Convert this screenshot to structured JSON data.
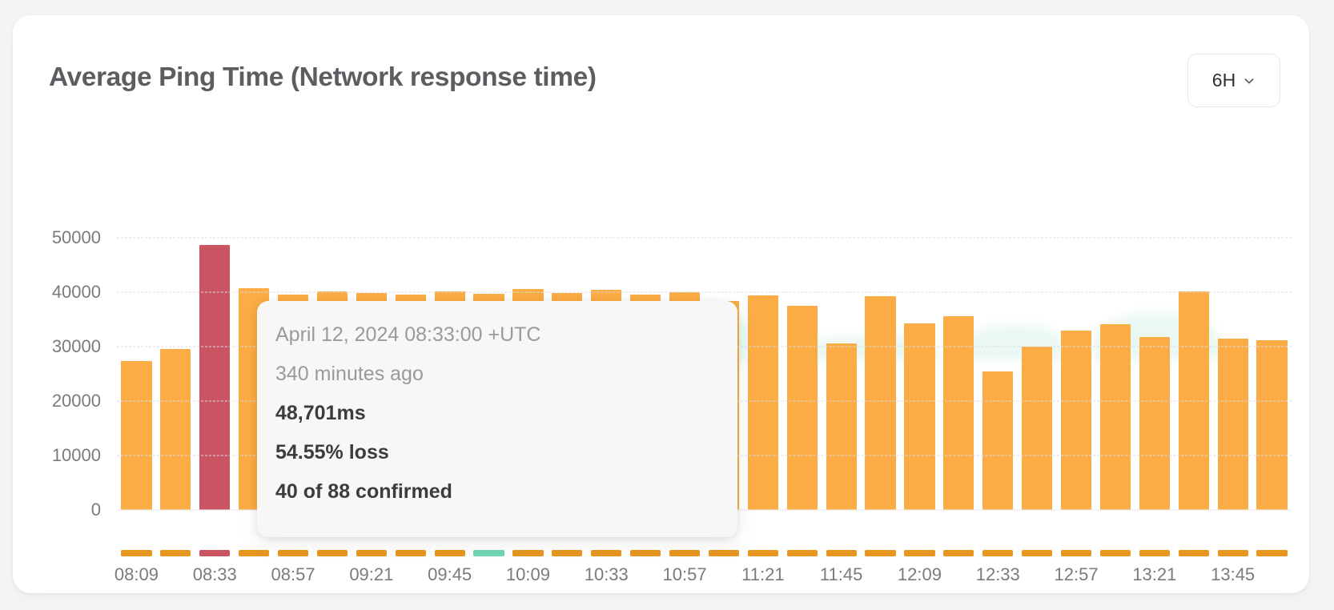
{
  "header": {
    "title": "Average Ping Time (Network response time)",
    "range_selector": {
      "label": "6H",
      "icon": "chevron-down-icon"
    }
  },
  "tooltip": {
    "timestamp": "April 12, 2024 08:33:00 +UTC",
    "relative": "340 minutes ago",
    "latency": "48,701ms",
    "loss": "54.55% loss",
    "confirmed": "40 of 88 confirmed"
  },
  "colors": {
    "bar": "#fbac44",
    "bar_highlight": "#cb5462",
    "status_ok": "#6fd6b5",
    "status_bad": "#cb5462",
    "grid": "#dddde2",
    "text_muted": "#7a7b80",
    "title": "#5d5d61",
    "card": "#ffffff",
    "page": "#f5f5f6"
  },
  "chart_data": {
    "type": "bar",
    "title": "Average Ping Time (Network response time)",
    "xlabel": "",
    "ylabel": "",
    "ylim": [
      0,
      55000
    ],
    "yticks": [
      0,
      10000,
      20000,
      30000,
      40000,
      50000
    ],
    "ytick_labels": [
      "0",
      "10000",
      "20000",
      "30000",
      "40000",
      "50000"
    ],
    "grid": true,
    "legend": false,
    "xtick_labels": [
      "08:09",
      "08:33",
      "08:57",
      "09:21",
      "09:45",
      "10:09",
      "10:33",
      "10:57",
      "11:21",
      "11:45",
      "12:09",
      "12:33",
      "12:57",
      "13:21",
      "13:45"
    ],
    "xtick_indices": [
      0,
      2,
      4,
      6,
      8,
      10,
      12,
      14,
      16,
      18,
      20,
      22,
      24,
      26,
      28
    ],
    "categories": [
      "08:09",
      "08:21",
      "08:33",
      "08:45",
      "08:57",
      "09:09",
      "09:21",
      "09:33",
      "09:45",
      "09:57",
      "10:09",
      "10:21",
      "10:33",
      "10:45",
      "10:57",
      "11:09",
      "11:21",
      "11:33",
      "11:45",
      "11:57",
      "12:09",
      "12:21",
      "12:33",
      "12:45",
      "12:57",
      "13:09",
      "13:21",
      "13:33",
      "13:45",
      "13:57"
    ],
    "values": [
      27300,
      29500,
      48701,
      40800,
      39600,
      40100,
      39800,
      39500,
      40200,
      39700,
      40600,
      39900,
      40500,
      39600,
      40000,
      38400,
      39400,
      37500,
      30600,
      39300,
      34300,
      35600,
      25500,
      30000,
      33000,
      34100,
      31800,
      40200,
      31500,
      31200
    ],
    "highlight_index": 2,
    "highlight_value": 48701,
    "bar_color": "#fbac44",
    "highlight_color": "#cb5462",
    "status_strip": {
      "ok_color": "#6fd6b5",
      "default_color": "#e8961f",
      "ok_indices": [
        9
      ]
    }
  }
}
